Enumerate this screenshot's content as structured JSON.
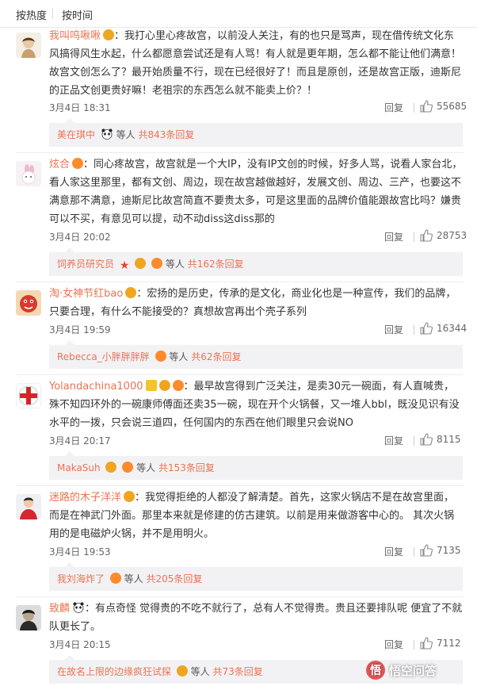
{
  "sort_tabs": {
    "hot": "按热度",
    "time": "按时间"
  },
  "labels": {
    "reply": "回复"
  },
  "colors": {
    "username": "#eb7350",
    "sub_bg": "#f2f2f5"
  },
  "comments": [
    {
      "user": "我叫呜啾啾",
      "text": "：我打心里心疼故宫，以前没人关注，有的也只是骂声，现在借传统文化东风搞得风生水起，什么都愿意尝试还是有人骂！有人就是更年期，怎么都不能让他们满意！故宫文创怎么了？最开始质量不行，现在已经很好了！而且是原创，还是故宫正版，迪斯尼的正品文创更贵好嘛！老祖宗的东西怎么就不能卖上价？！",
      "time": "3月4日 18:31",
      "likes": "55685",
      "sub_user": "美在琪中",
      "sub_mid": "等人",
      "sub_count": "共843条回复"
    },
    {
      "user": "炫合",
      "text": "：同心疼故宫，故宫就是一个大IP，没有IP文创的时候，好多人骂，说看人家台北，看人家这里那里，都有文创、周边，现在故宫越做越好，发展文创、周边、三产，也要这不满意那不满意，迪斯尼比故宫简直不要贵太多，可是这里面的品牌价值能跟故宫比吗？嫌贵可以不买，有意见可以提，动不动diss这diss那的",
      "time": "3月4日 20:02",
      "likes": "28753",
      "sub_user": "饲养员研究员",
      "sub_mid": "等人",
      "sub_count": "共162条回复"
    },
    {
      "user": "淘·女神节红bao",
      "text": "：宏扬的是历史，传承的是文化，商业化也是一种宣传，我们的品牌，只要合理，有什么不能接受的？真想故宫再出个壳子系列",
      "time": "3月4日 19:59",
      "likes": "16344",
      "sub_user": "Rebecca_小胖胖胖胖",
      "sub_mid": "等人",
      "sub_count": "共62条回复"
    },
    {
      "user": "Yolandachina1000",
      "text": "：最早故宫得到广泛关注，是卖30元一碗面，有人直喊贵，殊不知四环外的一碗康师傅面还卖35一碗，现在开个火锅餐，又一堆人bbl，既没见识有没水平的一拨，只会说三道四，任何国内的东西在他们眼里只会说NO",
      "time": "3月4日 20:17",
      "likes": "8115",
      "sub_user": "MakaSuh",
      "sub_mid": "等人",
      "sub_count": "共153条回复"
    },
    {
      "user": "迷路的木子洋洋",
      "text": "：我觉得拒绝的人都没了解清楚。首先，这家火锅店不是在故宫里面，而是在神武门外面。那里本来就是修建的仿古建筑。以前是用来做游客中心的。 其次火锅用的是电磁炉火锅，并不是用明火。",
      "time": "3月4日 19:53",
      "likes": "7135",
      "sub_user": "我刘海炸了",
      "sub_mid": "等人",
      "sub_count": "共205条回复"
    },
    {
      "user": "致麟",
      "text": "：有点奇怪 觉得贵的不吃不就行了，总有人不觉得贵。贵且还要排队呢 便宜了不就队更长了。",
      "time": "3月4日 20:15",
      "likes": "7112",
      "sub_user": "在故名上限的边缘疯狂试探",
      "sub_mid": "等人",
      "sub_count": "共73条回复"
    }
  ],
  "watermark": {
    "text": "悟空问答",
    "logo_glyph": "悟"
  }
}
